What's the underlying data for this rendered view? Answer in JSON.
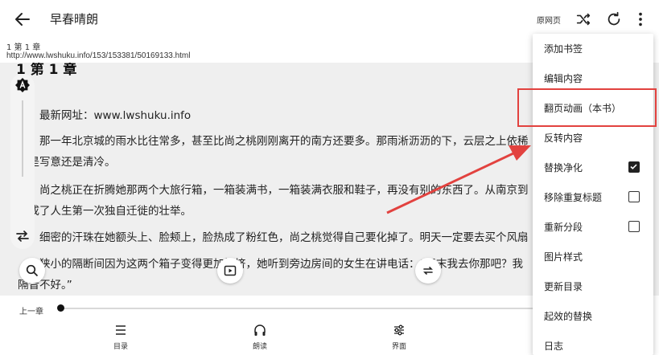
{
  "appbar": {
    "title": "早春晴朗",
    "original_page": "原网页"
  },
  "chapter_info": {
    "title": "1 第 1 章",
    "url": "http://www.lwshuku.info/153/153381/50169133.html"
  },
  "reader": {
    "heading": "1 第 1 章",
    "paragraphs": [
      "最新网址：www.lwshuku.info",
      "那一年北京城的雨水比往常多，甚至比尚之桃刚刚离开的南方还要多。那雨淅沥沥的下，云层之上依稀",
      "景是写意还是清冷。",
      "尚之桃正在折腾她那两个大旅行箱，一箱装满书，一箱装满衣服和鞋子，再没有别的东西了。从南京到",
      "完成了人生第一次独自迁徙的壮举。",
      "细密的汗珠在她额头上、脸颊上，脸热成了粉红色，尚之桃觉得自己要化掉了。明天一定要去买个风扇",
      "狭小的隔断间因为这两个箱子变得更加拥挤，她听到旁边房间的女生在讲电话：“周末我去你那吧？我",
      "隔音不好。”"
    ]
  },
  "bottom": {
    "prev_chapter": "上一章",
    "nav": [
      {
        "label": "目录",
        "icon": "toc-icon"
      },
      {
        "label": "朗读",
        "icon": "headphones-icon"
      },
      {
        "label": "界面",
        "icon": "sliders-icon"
      }
    ],
    "progress": 0
  },
  "menu": {
    "items": [
      {
        "label": "添加书签"
      },
      {
        "label": "编辑内容"
      },
      {
        "label": "翻页动画（本书）"
      },
      {
        "label": "反转内容"
      },
      {
        "label": "替换净化",
        "checked": true
      },
      {
        "label": "移除重复标题",
        "checked": false
      },
      {
        "label": "重新分段",
        "checked": false
      },
      {
        "label": "图片样式"
      },
      {
        "label": "更新目录"
      },
      {
        "label": "起效的替换"
      },
      {
        "label": "日志"
      }
    ]
  },
  "colors": {
    "annotation": "#e2423f",
    "reader_bg": "#efefef"
  }
}
